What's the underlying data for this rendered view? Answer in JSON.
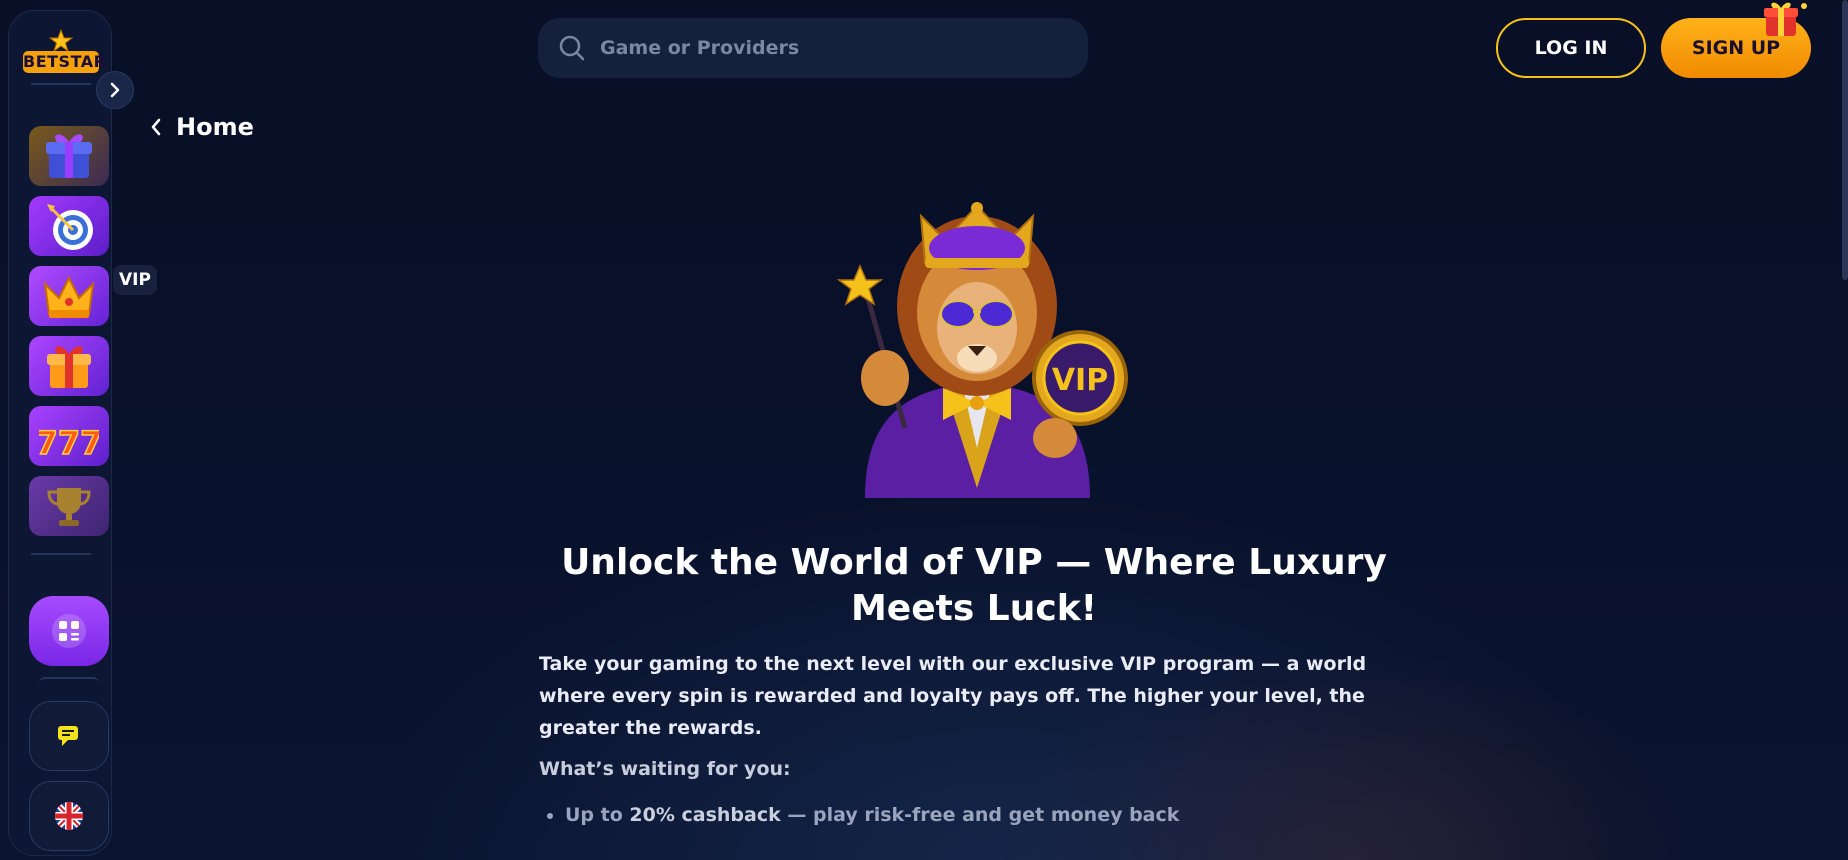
{
  "brand": {
    "logo_text": "BETSTAR"
  },
  "search": {
    "placeholder": "Game or Providers"
  },
  "header": {
    "login_label": "LOG IN",
    "signup_label": "SIGN UP"
  },
  "sidebar": {
    "tooltip": "VIP",
    "items": [
      {
        "name": "gift-box"
      },
      {
        "name": "target"
      },
      {
        "name": "vip-crown"
      },
      {
        "name": "promo-gift"
      },
      {
        "name": "slots-777"
      },
      {
        "name": "trophy"
      }
    ]
  },
  "breadcrumb": {
    "back_label": "Home"
  },
  "hero": {
    "title": "Unlock the World of VIP — Where Luxury Meets Luck!",
    "intro": "Take your gaming to the next level with our exclusive VIP program — a world where every spin is rewarded and loyalty pays off. The higher your level, the greater the rewards.",
    "subhead": "What’s waiting for you:",
    "benefits": [
      {
        "prefix": "Up to ",
        "highlight": "20% cashback",
        "suffix": " — play risk-free and get money back"
      }
    ],
    "badge_text": "VIP"
  },
  "colors": {
    "background": "#080f26",
    "accent_orange": "#f7a20e",
    "accent_purple": "#9b3dff",
    "login_border": "#f7c21a"
  }
}
